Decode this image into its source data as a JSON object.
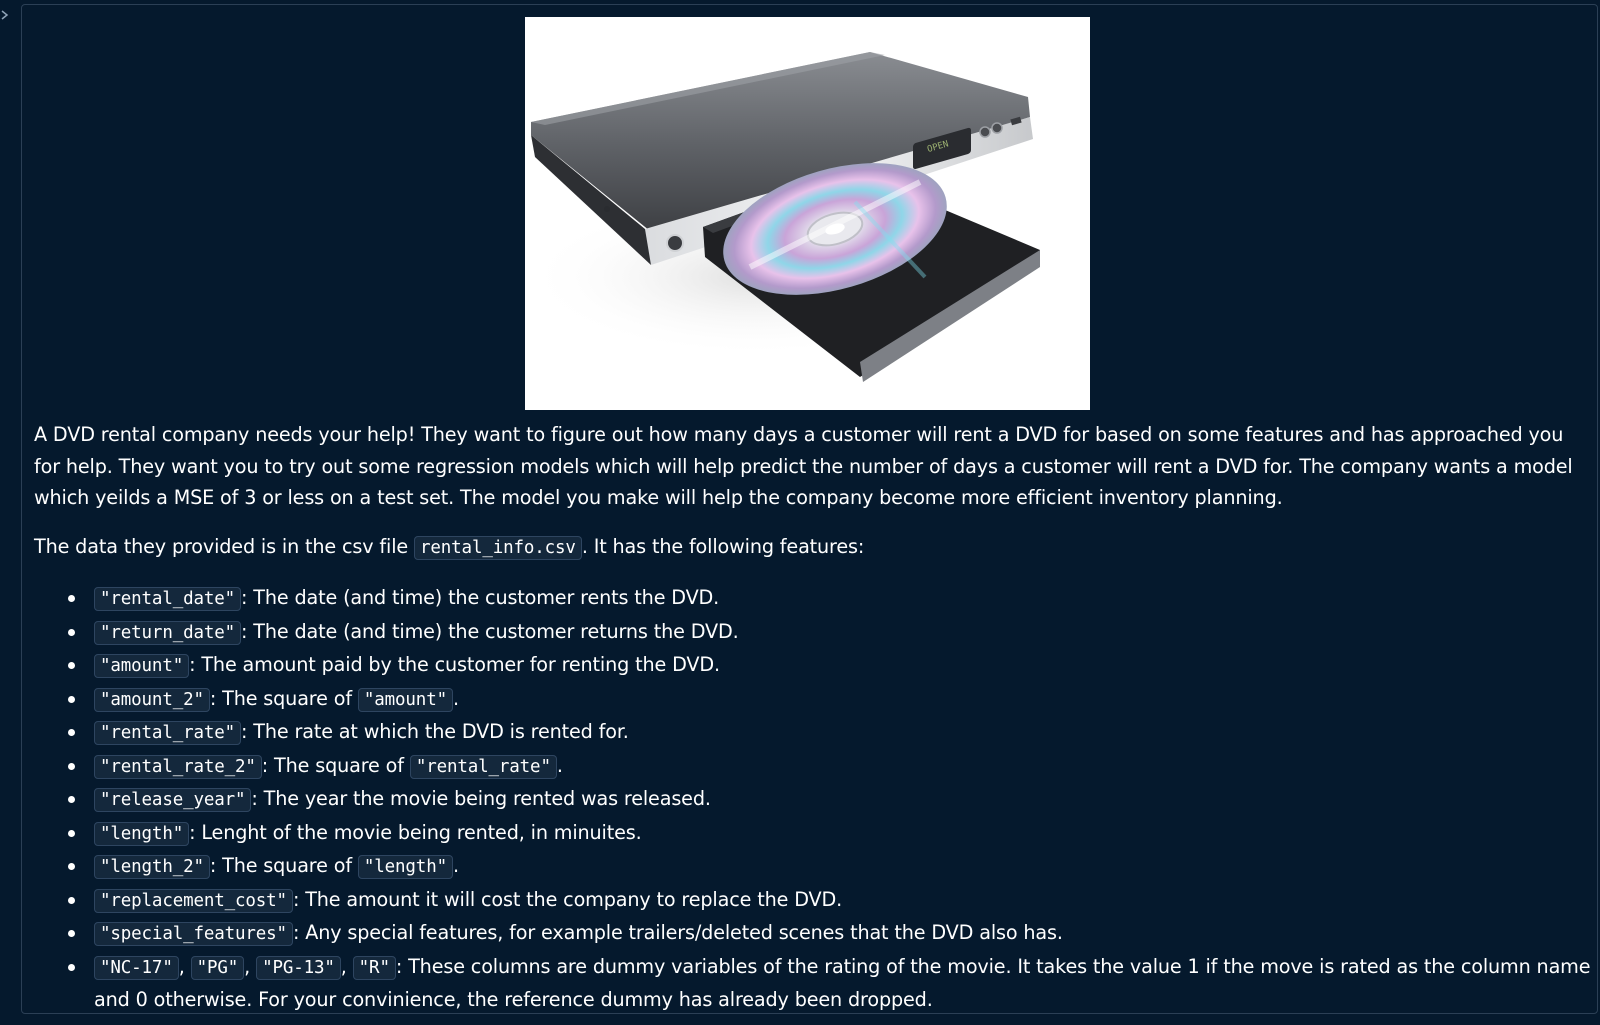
{
  "intro_paragraph": "A DVD rental company needs your help! They want to figure out how many days a customer will rent a DVD for based on some features and has approached you for help. They want you to try out some regression models which will help predict the number of days a customer will rent a DVD for. The company wants a model which yeilds a MSE of 3 or less on a test set. The model you make will help the company become more efficient inventory planning.",
  "data_line": {
    "prefix": "The data they provided is in the csv file ",
    "file_name": "rental_info.csv",
    "suffix": ". It has the following features:"
  },
  "features": [
    {
      "code": "\"rental_date\"",
      "text": ": The date (and time) the customer rents the DVD."
    },
    {
      "code": "\"return_date\"",
      "text": ": The date (and time) the customer returns the DVD."
    },
    {
      "code": "\"amount\"",
      "text": ": The amount paid by the customer for renting the DVD."
    },
    {
      "code": "\"amount_2\"",
      "text": ": The square of ",
      "code2": "\"amount\"",
      "tail": "."
    },
    {
      "code": "\"rental_rate\"",
      "text": ": The rate at which the DVD is rented for."
    },
    {
      "code": "\"rental_rate_2\"",
      "text": ": The square of ",
      "code2": "\"rental_rate\"",
      "tail": "."
    },
    {
      "code": "\"release_year\"",
      "text": ": The year the movie being rented was released."
    },
    {
      "code": "\"length\"",
      "text": ": Lenght of the movie being rented, in minuites."
    },
    {
      "code": "\"length_2\"",
      "text": ": The square of ",
      "code2": "\"length\"",
      "tail": "."
    },
    {
      "code": "\"replacement_cost\"",
      "text": ": The amount it will cost the company to replace the DVD."
    },
    {
      "code": "\"special_features\"",
      "text": ": Any special features, for example trailers/deleted scenes that the DVD also has."
    }
  ],
  "ratings_feature": {
    "codes": [
      "\"NC-17\"",
      "\"PG\"",
      "\"PG-13\"",
      "\"R\""
    ],
    "separator": ", ",
    "text": ": These columns are dummy variables of the rating of the movie. It takes the value 1 if the move is rated as the column name and 0 otherwise. For your convinience, the reference dummy has already been dropped."
  },
  "dvd_display_text": "OPEN",
  "colors": {
    "background": "#05192d",
    "text": "#ffffff",
    "code_background": "#14283c",
    "cell_border": "#2b3f55"
  }
}
